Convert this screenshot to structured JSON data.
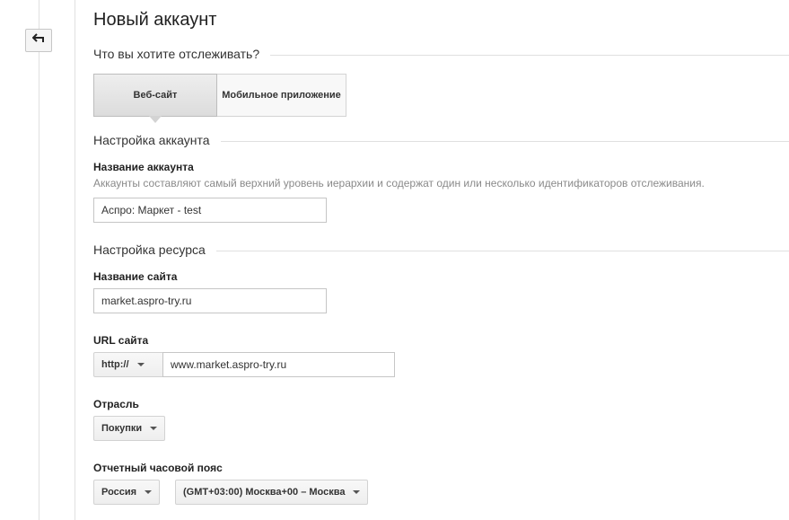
{
  "page": {
    "title": "Новый аккаунт"
  },
  "tracking": {
    "question": "Что вы хотите отслеживать?",
    "tabs": [
      {
        "label": "Веб-сайт",
        "active": true
      },
      {
        "label": "Мобильное приложение",
        "active": false
      }
    ]
  },
  "account": {
    "section_title": "Настройка аккаунта",
    "name_label": "Название аккаунта",
    "name_hint": "Аккаунты составляют самый верхний уровень иерархии и содержат один или несколько идентификаторов отслеживания.",
    "name_value": "Аспро: Маркет - test"
  },
  "resource": {
    "section_title": "Настройка ресурса",
    "site_name_label": "Название сайта",
    "site_name_value": "market.aspro-try.ru",
    "url_label": "URL сайта",
    "protocol": "http://",
    "url_value": "www.market.aspro-try.ru",
    "industry_label": "Отрасль",
    "industry_value": "Покупки",
    "timezone_label": "Отчетный часовой пояс",
    "country_value": "Россия",
    "timezone_value": "(GMT+03:00) Москва+00 – Москва"
  },
  "icons": {
    "back": "back-arrow-icon",
    "dropdown": "caret-down-icon"
  },
  "colors": {
    "border": "#c6c6c6",
    "divider": "#e0e0e0",
    "hint": "#8a8a8a"
  }
}
